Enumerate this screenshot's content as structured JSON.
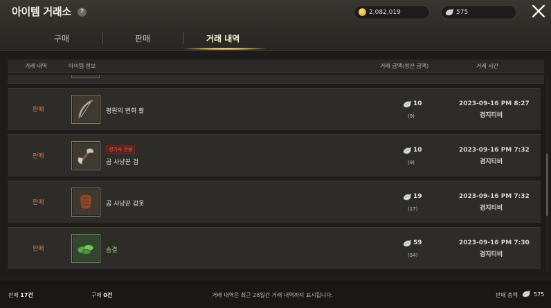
{
  "header": {
    "title": "아이템 거래소",
    "help": "?",
    "gold_amount": "2,082,019",
    "silver_amount": "575"
  },
  "tabs": [
    {
      "label": "구매",
      "active": false
    },
    {
      "label": "판매",
      "active": false
    },
    {
      "label": "거래 내역",
      "active": true
    }
  ],
  "columns": {
    "history": "거래 내역",
    "item_info": "아이템 정보",
    "amount": "거래 금액(정산 금액)",
    "time": "거래 시간"
  },
  "rows": [
    {
      "type": "판매",
      "name": "평원의 변화 활",
      "badge": "",
      "price": "10",
      "settle": "(9)",
      "date": "2023-09-16 PM 8:27",
      "server": "겸지티비",
      "icon": "bow-icon"
    },
    {
      "type": "판매",
      "name": "곰 사냥꾼 검",
      "badge": "성기사 전용",
      "price": "10",
      "settle": "(9)",
      "date": "2023-09-16 PM 7:32",
      "server": "겸지티비",
      "icon": "axe-icon"
    },
    {
      "type": "판매",
      "name": "곰 사냥꾼 갑옷",
      "badge": "",
      "price": "19",
      "settle": "(17)",
      "date": "2023-09-16 PM 7:32",
      "server": "겸지티비",
      "icon": "armor-icon"
    },
    {
      "type": "판매",
      "name": "솜결",
      "badge": "",
      "price": "59",
      "settle": "(54)",
      "date": "2023-09-16 PM 7:30",
      "server": "겸지티비",
      "icon": "leaf-icon"
    }
  ],
  "footer": {
    "sell_label": "판매",
    "sell_count": "17건",
    "buy_label": "구매",
    "buy_count": "0건",
    "note": "거래 내역은 최근 28일간 거래 내역까지 표시됩니다.",
    "total_label": "판매 총액",
    "total": "575"
  },
  "colors": {
    "sell_type": "#e07a3a",
    "material_name": "#8fcf6b",
    "badge_text": "#e4705a"
  }
}
